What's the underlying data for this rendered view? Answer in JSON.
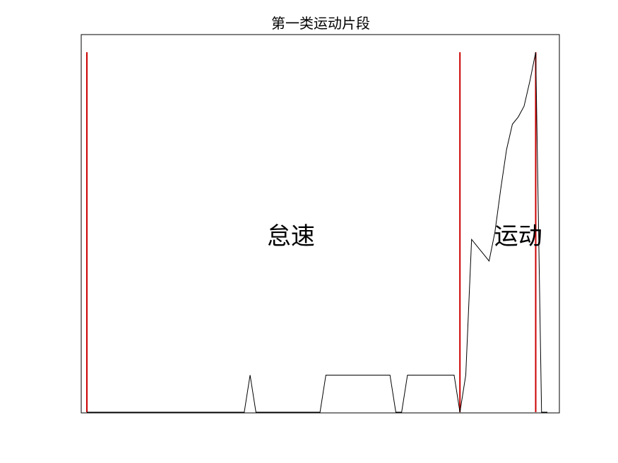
{
  "chart_data": {
    "type": "line",
    "title": "第一类运动片段",
    "xlabel": "",
    "ylabel": "",
    "grid": false,
    "show_ticks": false,
    "xlim": [
      0,
      80
    ],
    "ylim": [
      0,
      1
    ],
    "series": [
      {
        "color": "#000000",
        "x": [
          0,
          1,
          2,
          3,
          4,
          5,
          6,
          7,
          8,
          9,
          10,
          11,
          12,
          13,
          14,
          15,
          16,
          17,
          18,
          19,
          20,
          21,
          22,
          23,
          24,
          25,
          26,
          27,
          28,
          29,
          30,
          31,
          32,
          33,
          34,
          35,
          36,
          37,
          38,
          39,
          40,
          41,
          42,
          43,
          44,
          45,
          46,
          47,
          48,
          49,
          50,
          51,
          52,
          53,
          54,
          55,
          56,
          57,
          58,
          59,
          60,
          61,
          62,
          63,
          64,
          65,
          66,
          67,
          68,
          69,
          70,
          71,
          72,
          73,
          74,
          75,
          76,
          77,
          78,
          79
        ],
        "y": [
          0,
          0,
          0,
          0,
          0,
          0,
          0,
          0,
          0,
          0,
          0,
          0,
          0,
          0,
          0,
          0,
          0,
          0,
          0,
          0,
          0,
          0,
          0,
          0,
          0,
          0,
          0,
          0,
          0.103,
          0,
          0,
          0,
          0,
          0,
          0,
          0,
          0,
          0,
          0,
          0,
          0,
          0.103,
          0.103,
          0.103,
          0.103,
          0.103,
          0.103,
          0.103,
          0.103,
          0.103,
          0.103,
          0.103,
          0.103,
          0,
          0,
          0.103,
          0.103,
          0.103,
          0.103,
          0.103,
          0.103,
          0.103,
          0.103,
          0.103,
          0,
          0.103,
          0.48,
          0.46,
          0.44,
          0.42,
          0.5,
          0.62,
          0.73,
          0.8,
          0.82,
          0.85,
          0.92,
          1,
          0,
          0
        ]
      }
    ],
    "vlines": {
      "color": "#cc0000",
      "x": [
        0,
        64,
        77
      ]
    },
    "annotations": [
      {
        "text": "怠速",
        "x": 35,
        "y": 0.49
      },
      {
        "text": "运动",
        "x": 74,
        "y": 0.49
      }
    ]
  }
}
